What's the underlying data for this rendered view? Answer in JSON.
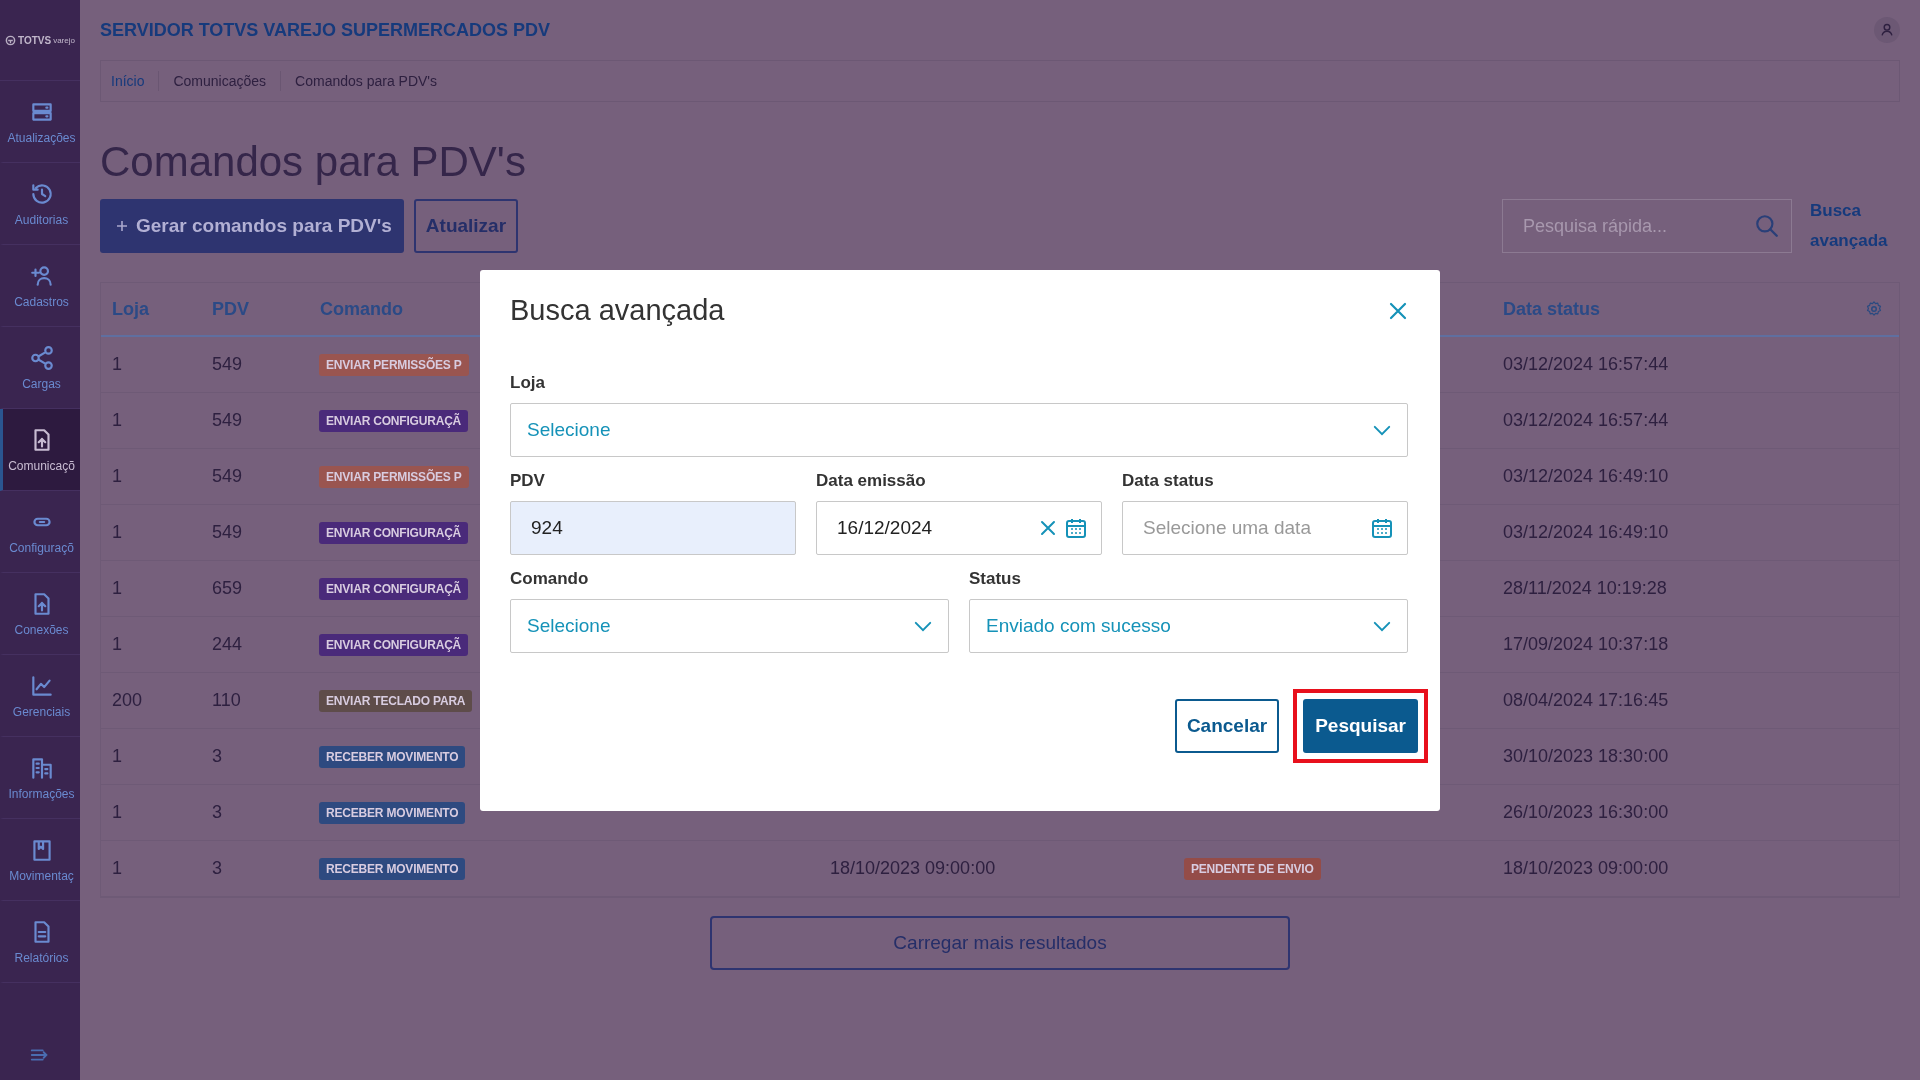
{
  "sidebar": {
    "logo": {
      "brand": "TOTVS",
      "sub": "varejo"
    },
    "items": [
      {
        "label": "Atualizações",
        "selected": false
      },
      {
        "label": "Auditorias",
        "selected": false
      },
      {
        "label": "Cadastros",
        "selected": false
      },
      {
        "label": "Cargas",
        "selected": false
      },
      {
        "label": "Comunicaçõ",
        "selected": true
      },
      {
        "label": "Configuraçõ",
        "selected": false
      },
      {
        "label": "Conexões",
        "selected": false
      },
      {
        "label": "Gerenciais",
        "selected": false
      },
      {
        "label": "Informações",
        "selected": false
      },
      {
        "label": "Movimentaç",
        "selected": false
      },
      {
        "label": "Relatórios",
        "selected": false
      }
    ]
  },
  "header": {
    "title": "SERVIDOR TOTVS VAREJO SUPERMERCADOS PDV"
  },
  "breadcrumb": [
    {
      "label": "Início",
      "link": true
    },
    {
      "label": "Comunicações",
      "link": false
    },
    {
      "label": "Comandos para PDV's",
      "link": false
    }
  ],
  "page_title": "Comandos para PDV's",
  "actions": {
    "primary": "Gerar comandos para PDV's",
    "secondary": "Atualizar"
  },
  "search": {
    "placeholder": "Pesquisa rápida...",
    "advanced_link": "Busca avançada"
  },
  "table": {
    "columns": {
      "column_1": "Loja",
      "column_2": "PDV",
      "column_3": "Comando",
      "column_6": "Data status"
    },
    "rows": [
      {
        "column_1": "1",
        "column_2": "549",
        "column_3": {
          "text": "ENVIAR PERMISSÕES P",
          "color": "#9a5550"
        },
        "column_6": "03/12/2024 16:57:44"
      },
      {
        "column_1": "1",
        "column_2": "549",
        "column_3": {
          "text": "ENVIAR CONFIGURAÇÃ",
          "color": "#4a2a7a"
        },
        "column_6": "03/12/2024 16:57:44"
      },
      {
        "column_1": "1",
        "column_2": "549",
        "column_3": {
          "text": "ENVIAR PERMISSÕES P",
          "color": "#9a5550"
        },
        "column_6": "03/12/2024 16:49:10"
      },
      {
        "column_1": "1",
        "column_2": "549",
        "column_3": {
          "text": "ENVIAR CONFIGURAÇÃ",
          "color": "#4a2a7a"
        },
        "column_6": "03/12/2024 16:49:10"
      },
      {
        "column_1": "1",
        "column_2": "659",
        "column_3": {
          "text": "ENVIAR CONFIGURAÇÃ",
          "color": "#4a2a7a"
        },
        "column_6": "28/11/2024 10:19:28"
      },
      {
        "column_1": "1",
        "column_2": "244",
        "column_3": {
          "text": "ENVIAR CONFIGURAÇÃ",
          "color": "#4a2a7a"
        },
        "column_6": "17/09/2024 10:37:18"
      },
      {
        "column_1": "200",
        "column_2": "110",
        "column_3": {
          "text": "ENVIAR TECLADO PARA",
          "color": "#5e4c4a"
        },
        "column_6": "08/04/2024 17:16:45"
      },
      {
        "column_1": "1",
        "column_2": "3",
        "column_3": {
          "text": "RECEBER MOVIMENTO",
          "color": "#2e4a80"
        },
        "column_6": "30/10/2023 18:30:00"
      },
      {
        "column_1": "1",
        "column_2": "3",
        "column_3": {
          "text": "RECEBER MOVIMENTO",
          "color": "#2e4a80"
        },
        "column_6": "26/10/2023 16:30:00"
      },
      {
        "column_1": "1",
        "column_2": "3",
        "column_3": {
          "text": "RECEBER MOVIMENTO",
          "color": "#2e4a80"
        },
        "column_4": "18/10/2023 09:00:00",
        "column_5": {
          "text": "PENDENTE DE ENVIO",
          "color": "#944c48"
        },
        "column_6": "18/10/2023 09:00:00"
      }
    ]
  },
  "load_more": "Carregar mais resultados",
  "modal": {
    "title": "Busca avançada",
    "rows": [
      [
        {
          "kind": "select",
          "label": "Loja",
          "value": "Selecione"
        }
      ],
      [
        {
          "kind": "text",
          "label": "PDV",
          "value": "924"
        },
        {
          "kind": "date",
          "label": "Data emissão",
          "value": "16/12/2024"
        },
        {
          "kind": "date",
          "label": "Data status",
          "placeholder": "Selecione uma data"
        }
      ],
      [
        {
          "kind": "select",
          "label": "Comando",
          "value": "Selecione"
        },
        {
          "kind": "select",
          "label": "Status",
          "value": "Enviado com sucesso"
        }
      ]
    ],
    "buttons": [
      {
        "label": "Cancelar",
        "kind": "secondary",
        "highlighted": false
      },
      {
        "label": "Pesquisar",
        "kind": "primary",
        "highlighted": true
      }
    ]
  }
}
